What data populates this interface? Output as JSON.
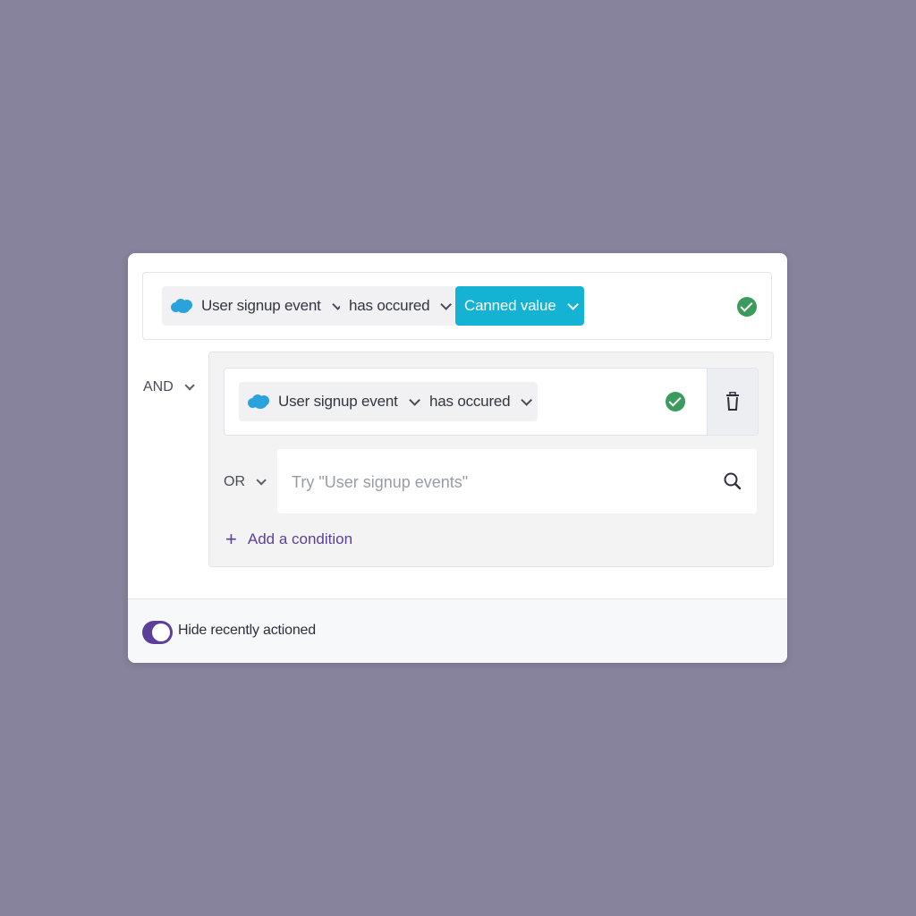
{
  "condition_row_1": {
    "event_label": "User signup event",
    "operator_label": "has occured",
    "value_label": "Canned value",
    "status_icon": "check-circle-icon",
    "source_icon": "salesforce-cloud-icon"
  },
  "group_operator": "AND",
  "nested_group": {
    "condition_row": {
      "event_label": "User signup event",
      "operator_label": "has occured",
      "status_icon": "check-circle-icon",
      "delete_icon": "trash-icon"
    },
    "or_operator": "OR",
    "search": {
      "placeholder": "Try \"User signup events\"",
      "value": "",
      "icon": "search-icon"
    },
    "add_condition_label": "Add a condition",
    "add_icon": "plus-icon"
  },
  "footer": {
    "toggle_label": "Hide recently actioned",
    "toggle_on": true
  },
  "colors": {
    "background": "#88839c",
    "accent_purple": "#5b3f9a",
    "chip_cyan": "#15b3d3",
    "success_green": "#3b9b5c",
    "salesforce_blue": "#2aa3dc"
  }
}
